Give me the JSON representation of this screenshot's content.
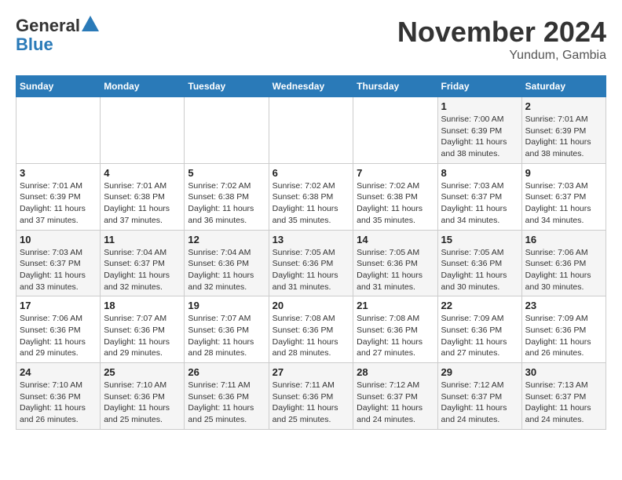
{
  "header": {
    "logo_general": "General",
    "logo_blue": "Blue",
    "month_title": "November 2024",
    "location": "Yundum, Gambia"
  },
  "weekdays": [
    "Sunday",
    "Monday",
    "Tuesday",
    "Wednesday",
    "Thursday",
    "Friday",
    "Saturday"
  ],
  "weeks": [
    [
      {
        "day": "",
        "info": ""
      },
      {
        "day": "",
        "info": ""
      },
      {
        "day": "",
        "info": ""
      },
      {
        "day": "",
        "info": ""
      },
      {
        "day": "",
        "info": ""
      },
      {
        "day": "1",
        "info": "Sunrise: 7:00 AM\nSunset: 6:39 PM\nDaylight: 11 hours\nand 38 minutes."
      },
      {
        "day": "2",
        "info": "Sunrise: 7:01 AM\nSunset: 6:39 PM\nDaylight: 11 hours\nand 38 minutes."
      }
    ],
    [
      {
        "day": "3",
        "info": "Sunrise: 7:01 AM\nSunset: 6:39 PM\nDaylight: 11 hours\nand 37 minutes."
      },
      {
        "day": "4",
        "info": "Sunrise: 7:01 AM\nSunset: 6:38 PM\nDaylight: 11 hours\nand 37 minutes."
      },
      {
        "day": "5",
        "info": "Sunrise: 7:02 AM\nSunset: 6:38 PM\nDaylight: 11 hours\nand 36 minutes."
      },
      {
        "day": "6",
        "info": "Sunrise: 7:02 AM\nSunset: 6:38 PM\nDaylight: 11 hours\nand 35 minutes."
      },
      {
        "day": "7",
        "info": "Sunrise: 7:02 AM\nSunset: 6:38 PM\nDaylight: 11 hours\nand 35 minutes."
      },
      {
        "day": "8",
        "info": "Sunrise: 7:03 AM\nSunset: 6:37 PM\nDaylight: 11 hours\nand 34 minutes."
      },
      {
        "day": "9",
        "info": "Sunrise: 7:03 AM\nSunset: 6:37 PM\nDaylight: 11 hours\nand 34 minutes."
      }
    ],
    [
      {
        "day": "10",
        "info": "Sunrise: 7:03 AM\nSunset: 6:37 PM\nDaylight: 11 hours\nand 33 minutes."
      },
      {
        "day": "11",
        "info": "Sunrise: 7:04 AM\nSunset: 6:37 PM\nDaylight: 11 hours\nand 32 minutes."
      },
      {
        "day": "12",
        "info": "Sunrise: 7:04 AM\nSunset: 6:36 PM\nDaylight: 11 hours\nand 32 minutes."
      },
      {
        "day": "13",
        "info": "Sunrise: 7:05 AM\nSunset: 6:36 PM\nDaylight: 11 hours\nand 31 minutes."
      },
      {
        "day": "14",
        "info": "Sunrise: 7:05 AM\nSunset: 6:36 PM\nDaylight: 11 hours\nand 31 minutes."
      },
      {
        "day": "15",
        "info": "Sunrise: 7:05 AM\nSunset: 6:36 PM\nDaylight: 11 hours\nand 30 minutes."
      },
      {
        "day": "16",
        "info": "Sunrise: 7:06 AM\nSunset: 6:36 PM\nDaylight: 11 hours\nand 30 minutes."
      }
    ],
    [
      {
        "day": "17",
        "info": "Sunrise: 7:06 AM\nSunset: 6:36 PM\nDaylight: 11 hours\nand 29 minutes."
      },
      {
        "day": "18",
        "info": "Sunrise: 7:07 AM\nSunset: 6:36 PM\nDaylight: 11 hours\nand 29 minutes."
      },
      {
        "day": "19",
        "info": "Sunrise: 7:07 AM\nSunset: 6:36 PM\nDaylight: 11 hours\nand 28 minutes."
      },
      {
        "day": "20",
        "info": "Sunrise: 7:08 AM\nSunset: 6:36 PM\nDaylight: 11 hours\nand 28 minutes."
      },
      {
        "day": "21",
        "info": "Sunrise: 7:08 AM\nSunset: 6:36 PM\nDaylight: 11 hours\nand 27 minutes."
      },
      {
        "day": "22",
        "info": "Sunrise: 7:09 AM\nSunset: 6:36 PM\nDaylight: 11 hours\nand 27 minutes."
      },
      {
        "day": "23",
        "info": "Sunrise: 7:09 AM\nSunset: 6:36 PM\nDaylight: 11 hours\nand 26 minutes."
      }
    ],
    [
      {
        "day": "24",
        "info": "Sunrise: 7:10 AM\nSunset: 6:36 PM\nDaylight: 11 hours\nand 26 minutes."
      },
      {
        "day": "25",
        "info": "Sunrise: 7:10 AM\nSunset: 6:36 PM\nDaylight: 11 hours\nand 25 minutes."
      },
      {
        "day": "26",
        "info": "Sunrise: 7:11 AM\nSunset: 6:36 PM\nDaylight: 11 hours\nand 25 minutes."
      },
      {
        "day": "27",
        "info": "Sunrise: 7:11 AM\nSunset: 6:36 PM\nDaylight: 11 hours\nand 25 minutes."
      },
      {
        "day": "28",
        "info": "Sunrise: 7:12 AM\nSunset: 6:37 PM\nDaylight: 11 hours\nand 24 minutes."
      },
      {
        "day": "29",
        "info": "Sunrise: 7:12 AM\nSunset: 6:37 PM\nDaylight: 11 hours\nand 24 minutes."
      },
      {
        "day": "30",
        "info": "Sunrise: 7:13 AM\nSunset: 6:37 PM\nDaylight: 11 hours\nand 24 minutes."
      }
    ]
  ]
}
